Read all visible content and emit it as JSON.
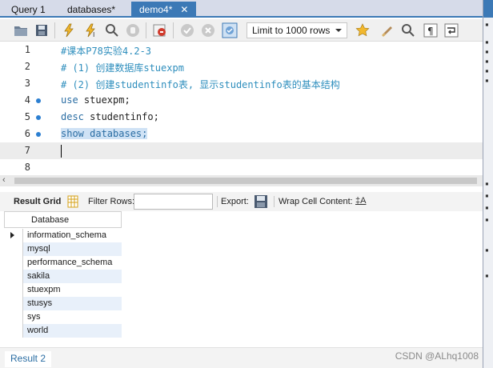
{
  "tabs": [
    {
      "label": "Query 1"
    },
    {
      "label": "databases*"
    },
    {
      "label": "demo4*",
      "close": "✕"
    }
  ],
  "toolbar": {
    "limit_label": "Limit to 1000 rows"
  },
  "editor": {
    "lines": [
      {
        "num": "1",
        "text": "#课本P78实验4.2-3"
      },
      {
        "num": "2",
        "text": "# (1) 创建数据库stuexpm"
      },
      {
        "num": "3",
        "text": "# (2) 创建studentinfo表, 显示studentinfo表的基本结构"
      },
      {
        "num": "4",
        "kw": "use",
        "rest": " stuexpm;"
      },
      {
        "num": "5",
        "kw": "desc",
        "rest": " studentinfo;"
      },
      {
        "num": "6",
        "kw": "show databases;",
        "rest": ""
      },
      {
        "num": "7",
        "text": ""
      },
      {
        "num": "8",
        "text": ""
      }
    ]
  },
  "results_toolbar": {
    "result_grid": "Result Grid",
    "filter_rows": "Filter Rows:",
    "export": "Export:",
    "wrap": "Wrap Cell Content:"
  },
  "grid": {
    "column": "Database",
    "rows": [
      "information_schema",
      "mysql",
      "performance_schema",
      "sakila",
      "stuexpm",
      "stusys",
      "sys",
      "world"
    ]
  },
  "bottom": {
    "result_tab": "Result 2"
  },
  "watermark": "CSDN @ALhq1008",
  "colors": {
    "accent": "#3c79b6",
    "comment": "#2e8ebd",
    "keyword": "#2a6da3",
    "selection": "#cfe2f5"
  }
}
